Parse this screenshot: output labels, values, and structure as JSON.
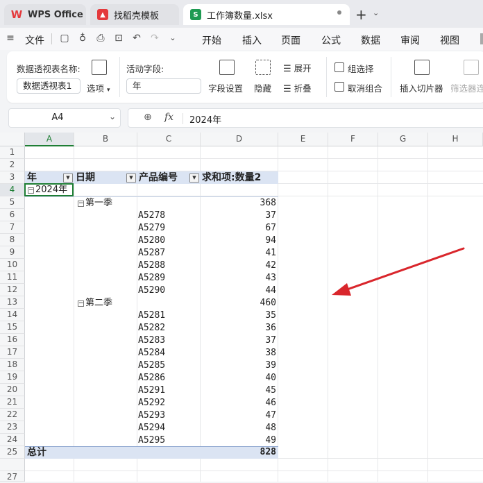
{
  "tabs": [
    {
      "label": "WPS Office",
      "icon": "wps-logo-icon"
    },
    {
      "label": "找稻壳模板",
      "icon": "docer-icon"
    },
    {
      "label": "工作簿数量.xlsx",
      "icon": "spreadsheet-s-icon"
    }
  ],
  "menu": {
    "file": "文件",
    "items": [
      "开始",
      "插入",
      "页面",
      "公式",
      "数据",
      "审阅",
      "视图"
    ]
  },
  "ribbon": {
    "pivot_name_label": "数据透视表名称:",
    "pivot_name_value": "数据透视表1",
    "options_label": "选项",
    "active_field_label": "活动字段:",
    "active_field_value": "年",
    "field_settings": "字段设置",
    "hide": "隐藏",
    "expand": "展开",
    "collapse": "折叠",
    "group_selection": "组选择",
    "ungroup": "取消组合",
    "insert_slicer": "插入切片器",
    "filter_connection": "筛选器连"
  },
  "formula_bar": {
    "cell_ref": "A4",
    "fx": "fx",
    "value": "2024年"
  },
  "columns": [
    "A",
    "B",
    "C",
    "D",
    "E",
    "F",
    "G",
    "H"
  ],
  "rows": [
    "1",
    "2",
    "3",
    "4",
    "5",
    "6",
    "7",
    "8",
    "9",
    "10",
    "11",
    "12",
    "13",
    "14",
    "15",
    "16",
    "17",
    "18",
    "19",
    "20",
    "21",
    "22",
    "23",
    "24",
    "25",
    "27"
  ],
  "pivot": {
    "headers": {
      "year": "年",
      "date": "日期",
      "product": "产品编号",
      "sum": "求和项:数量2"
    },
    "year_value": "2024年",
    "q1_label": "第一季",
    "q1_total": "368",
    "q1_items": [
      {
        "code": "A5278",
        "qty": "37"
      },
      {
        "code": "A5279",
        "qty": "67"
      },
      {
        "code": "A5280",
        "qty": "94"
      },
      {
        "code": "A5287",
        "qty": "41"
      },
      {
        "code": "A5288",
        "qty": "42"
      },
      {
        "code": "A5289",
        "qty": "43"
      },
      {
        "code": "A5290",
        "qty": "44"
      }
    ],
    "q2_label": "第二季",
    "q2_total": "460",
    "q2_items": [
      {
        "code": "A5281",
        "qty": "35"
      },
      {
        "code": "A5282",
        "qty": "36"
      },
      {
        "code": "A5283",
        "qty": "37"
      },
      {
        "code": "A5284",
        "qty": "38"
      },
      {
        "code": "A5285",
        "qty": "39"
      },
      {
        "code": "A5286",
        "qty": "40"
      },
      {
        "code": "A5291",
        "qty": "45"
      },
      {
        "code": "A5292",
        "qty": "46"
      },
      {
        "code": "A5293",
        "qty": "47"
      },
      {
        "code": "A5294",
        "qty": "48"
      },
      {
        "code": "A5295",
        "qty": "49"
      }
    ],
    "grand_total_label": "总计",
    "grand_total": "828"
  },
  "colors": {
    "accent_green": "#1e7e34",
    "pivot_header_bg": "#dbe4f3",
    "arrow_red": "#d9262c",
    "wps_red": "#e4393c"
  }
}
